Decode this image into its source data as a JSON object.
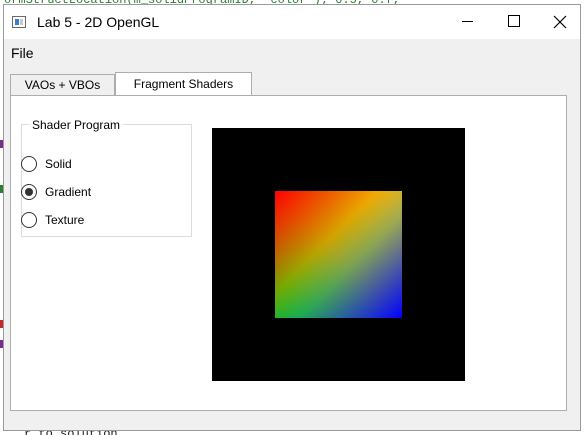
{
  "window": {
    "title": "Lab 5 - 2D OpenGL"
  },
  "menu": {
    "file_label": "File"
  },
  "tabs": [
    {
      "label": "VAOs + VBOs",
      "active": false
    },
    {
      "label": "Fragment Shaders",
      "active": true
    }
  ],
  "shader_group": {
    "title": "Shader Program",
    "options": [
      {
        "label": "Solid",
        "checked": false
      },
      {
        "label": "Gradient",
        "checked": true
      },
      {
        "label": "Texture",
        "checked": false
      }
    ]
  },
  "canvas": {
    "background": "#000000",
    "gradient_corners": {
      "top_left": "#ff0000",
      "top_right": "#ffff00",
      "bottom_left": "#00ff00",
      "bottom_right": "#0000ff"
    }
  }
}
